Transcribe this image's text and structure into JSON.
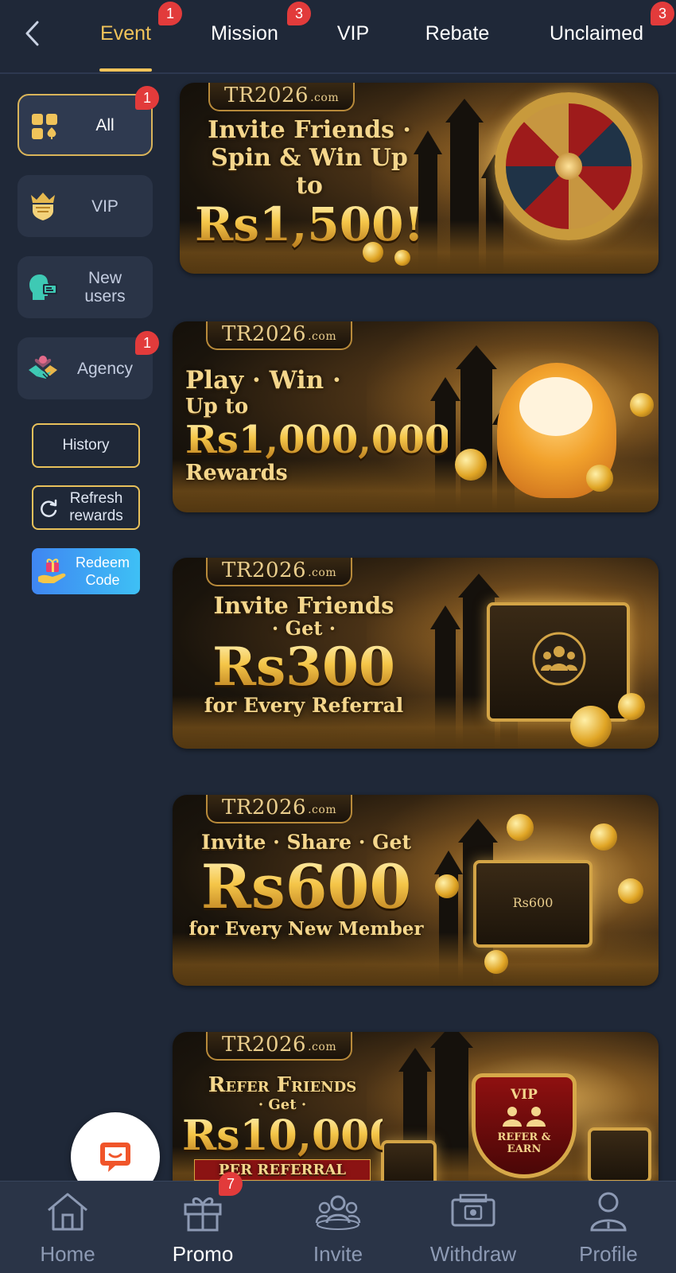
{
  "header": {
    "tabs": [
      {
        "label": "Event",
        "badge": "1",
        "active": true
      },
      {
        "label": "Mission",
        "badge": "3"
      },
      {
        "label": "VIP"
      },
      {
        "label": "Rebate"
      },
      {
        "label": "Unclaimed",
        "badge": "3"
      }
    ]
  },
  "sidebar": {
    "categories": [
      {
        "label": "All",
        "icon": "grid-suits-icon",
        "badge": "1",
        "active": true
      },
      {
        "label": "VIP",
        "icon": "crown-shield-icon"
      },
      {
        "label": "New users",
        "icon": "user-card-icon"
      },
      {
        "label": "Agency",
        "icon": "handshake-icon",
        "badge": "1"
      }
    ],
    "history_label": "History",
    "refresh_label": "Refresh rewards",
    "redeem_label": "Redeem Code"
  },
  "banners": [
    {
      "brand": "TR2026",
      "brand_suffix": ".com",
      "line1": "Invite Friends ·",
      "line2": "Spin & Win Up to",
      "amount": "Rs1,500!"
    },
    {
      "brand": "TR2026",
      "brand_suffix": ".com",
      "line1": "Play · Win ·",
      "line2": "Up to",
      "amount": "Rs1,000,000",
      "line3": "Rewards"
    },
    {
      "brand": "TR2026",
      "brand_suffix": ".com",
      "line1": "Invite Friends",
      "line2": "· Get ·",
      "amount": "Rs300",
      "line3": "for Every Referral"
    },
    {
      "brand": "TR2026",
      "brand_suffix": ".com",
      "line1": "Invite · Share · Get",
      "amount": "Rs600",
      "line3": "for Every New Member",
      "chest_text": "Rs600"
    },
    {
      "brand": "TR2026",
      "brand_suffix": ".com",
      "line1": "Refer Friends",
      "line2": "· Get ·",
      "amount": "Rs10,000",
      "strip": "PER REFERRAL",
      "shield_line1": "VIP",
      "shield_line2": "REFER &",
      "shield_line3": "EARN"
    }
  ],
  "bottom_nav": [
    {
      "label": "Home",
      "icon": "home-icon"
    },
    {
      "label": "Promo",
      "icon": "gift-icon",
      "badge": "7",
      "active": true
    },
    {
      "label": "Invite",
      "icon": "users-icon"
    },
    {
      "label": "Withdraw",
      "icon": "wallet-icon"
    },
    {
      "label": "Profile",
      "icon": "person-icon"
    }
  ],
  "colors": {
    "background": "#1f2838",
    "accent_gold": "#f0c35a",
    "badge_red": "#e23b3b",
    "nav_bg": "#2a3447"
  }
}
